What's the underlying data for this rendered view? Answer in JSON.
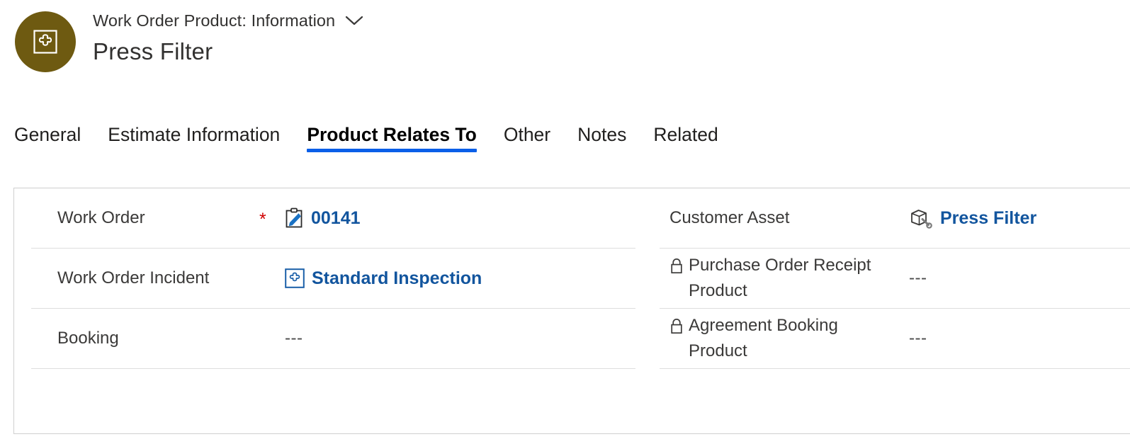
{
  "header": {
    "record_type": "Work Order Product: Information",
    "record_name": "Press Filter",
    "dropdown_icon": "chevron-down-icon",
    "avatar_icon": "work-order-product-icon",
    "avatar_color": "#6e5a11"
  },
  "tabs": [
    {
      "label": "General",
      "active": false
    },
    {
      "label": "Estimate Information",
      "active": false
    },
    {
      "label": "Product Relates To",
      "active": true
    },
    {
      "label": "Other",
      "active": false
    },
    {
      "label": "Notes",
      "active": false
    },
    {
      "label": "Related",
      "active": false
    }
  ],
  "theme": {
    "link_blue": "#12559e",
    "tab_underline": "#0b5fe8",
    "required_red": "#d00000",
    "divider": "#dedede",
    "card_border": "#cfcfcf"
  },
  "form": {
    "left_column": [
      {
        "label": "Work Order",
        "required": true,
        "locked": false,
        "icon": "clipboard-pen-icon",
        "value": "00141",
        "is_link": true
      },
      {
        "label": "Work Order Incident",
        "required": false,
        "locked": false,
        "icon": "work-order-incident-icon",
        "value": "Standard Inspection",
        "is_link": true
      },
      {
        "label": "Booking",
        "required": false,
        "locked": false,
        "icon": "",
        "value": "---",
        "is_link": false
      }
    ],
    "right_column": [
      {
        "label": "Customer Asset",
        "required": false,
        "locked": false,
        "icon": "customer-asset-icon",
        "value": "Press Filter",
        "is_link": true
      },
      {
        "label": "Purchase Order Receipt Product",
        "required": false,
        "locked": true,
        "icon": "",
        "value": "---",
        "is_link": false
      },
      {
        "label": "Agreement Booking Product",
        "required": false,
        "locked": true,
        "icon": "",
        "value": "---",
        "is_link": false
      }
    ]
  }
}
